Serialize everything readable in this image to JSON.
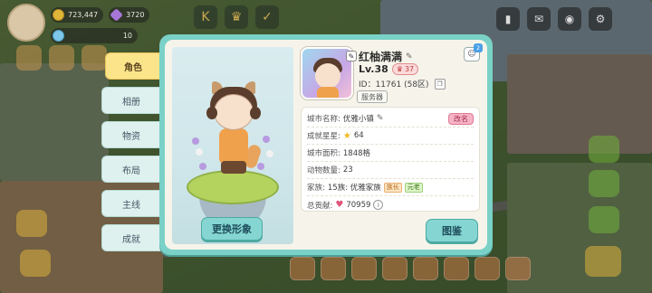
{
  "hud": {
    "coins": "723,447",
    "gems": "3720",
    "energy": "10"
  },
  "tabs": [
    {
      "label": "角色",
      "active": true
    },
    {
      "label": "相册",
      "active": false
    },
    {
      "label": "物资",
      "active": false
    },
    {
      "label": "布局",
      "active": false
    },
    {
      "label": "主线",
      "active": false
    },
    {
      "label": "成就",
      "active": false
    }
  ],
  "preview": {
    "change_button": "更换形象"
  },
  "profile": {
    "name": "红柚满满",
    "level": "Lv.38",
    "vip": "37",
    "id_text": "ID：11761 (58区)",
    "server_button": "服务器",
    "friend_badge": "2"
  },
  "info": {
    "city_name_label": "城市名称:",
    "city_name": "优雅小镇",
    "rename_button": "改名",
    "stars_label": "成就星星:",
    "stars": "64",
    "area_label": "城市面积:",
    "area": "1848格",
    "animals_label": "动物数量:",
    "animals": "23",
    "family_label": "家族:",
    "family": "15族: 优雅家族",
    "tag_leader": "族长",
    "tag_elder": "元老",
    "contribution_label": "总贡献:",
    "contribution": "70959"
  },
  "footer": {
    "illustrate_button": "图鉴"
  },
  "colors": {
    "dialog_frame": "#7ad1c7",
    "active_tab": "#fce48a",
    "rename": "#f7b3c6",
    "button_teal": "#85d6d2"
  }
}
